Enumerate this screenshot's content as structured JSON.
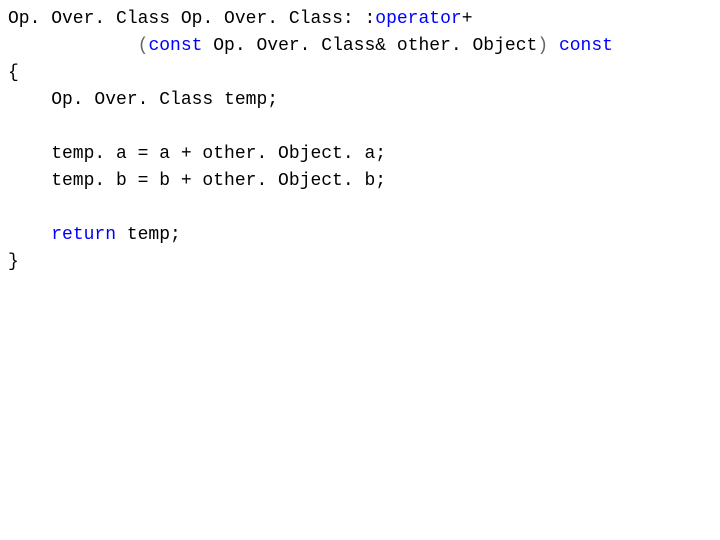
{
  "code": {
    "ret_type": "Op. Over. Class",
    "scope": "Op. Over. Class: :",
    "op_kw": "operator",
    "op_sym": "+",
    "indent1": "            ",
    "lparen": "(",
    "const_kw": "const",
    "param_type": " Op. Over. Class& ",
    "param_name": "other. Object",
    "rparen": ")",
    "trailing_const": "const",
    "open_brace": "{",
    "line_decl": "    Op. Over. Class temp;",
    "blank": "",
    "line_a": "    temp. a = a + other. Object. a;",
    "line_b": "    temp. b = b + other. Object. b;",
    "ret_indent": "    ",
    "return_kw": "return",
    "ret_expr": " temp;",
    "close_brace": "}"
  }
}
